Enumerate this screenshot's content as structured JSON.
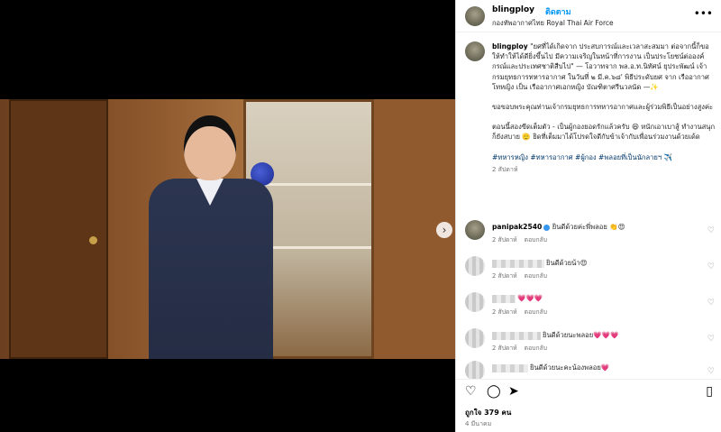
{
  "post": {
    "username": "blingploy",
    "follow_label": "ติดตาม",
    "location": "กองทัพอากาศไทย Royal Thai Air Force",
    "more_label": "•••",
    "next_label": "›"
  },
  "caption": {
    "username": "blingploy",
    "para1": "\"ยศที่ได้เกิดจาก ประสบการณ์และเวลาสะสมมา ต่อจากนี้ก็ขอให้ทำให้ได้ดียิ่งขึ้นไป มีความเจริญในหน้าที่การงาน เป็นประโยชน์ต่อองค์กรณ์และประเทศชาติสืบไป\" — โอวาทจาก พล.อ.ท.นิทัศน์ ยุประพัฒน์ เจ้ากรมยุทธการทหารอากาศ ในวันที่ ๒ มี.ค.๖๘' พิธีประดับยศ จาก เรืออากาศโทหญิง เป็น เรืออากาศเอกหญิง บัณฑิตาศรีนวลนัด —✨",
    "para2": "ขอขอบพระคุณท่านเจ้ากรมยุทธการทหารอากาศและผู้ร่วมพิธีเป็นอย่างสูงค่ะ",
    "para3": "ตอนนี้สองขีดเต็มตัว - เป็นผู้กองยอดรักแล้วครับ 😆 หนักเอาเบาสู้ ทำงานสนุกก็ยังสบาย 🫡 ยิดที่เต็มมาได้โปรดใจดีกับข้าเจ้ากับเพื่อนร่วมงานด้วยเด้ด",
    "tags": "#ทหารหญิง #ทหารอากาศ #ผู้กอง #พลอยที่เป็นนักลายฯ ✈️",
    "time": "2 สัปดาห์"
  },
  "comments": [
    {
      "user": "panipak2540",
      "text": "ยินดีด้วยค่ะพี่พลอย 👏😍",
      "time": "2 สัปดาห์",
      "reply": "ตอบกลับ"
    },
    {
      "user": "",
      "text": "ยินดีด้วยน้า😍",
      "time": "2 สัปดาห์",
      "reply": "ตอบกลับ"
    },
    {
      "user": "",
      "text": "💗💗💗",
      "time": "2 สัปดาห์",
      "reply": "ตอบกลับ"
    },
    {
      "user": "",
      "text": "ยินดีด้วยนะพลอย💗💗💗",
      "time": "2 สัปดาห์",
      "reply": "ตอบกลับ"
    },
    {
      "user": "",
      "text": "ยินดีด้วยนะคะน้องพลอย💗",
      "time": "",
      "reply": ""
    }
  ],
  "footer": {
    "likes": "ถูกใจ 379 คน",
    "date": "4 มีนาคม"
  },
  "colors": {
    "link": "#0095f6",
    "tag": "#00376b",
    "muted": "#737373"
  }
}
